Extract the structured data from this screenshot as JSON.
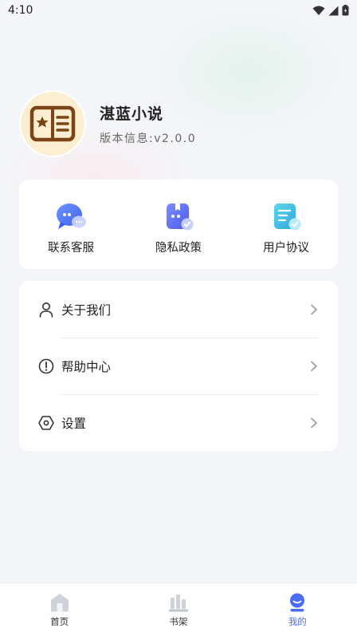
{
  "status_bar": {
    "time": "4:10"
  },
  "profile": {
    "name": "湛蓝小说",
    "version": "版本信息:v2.0.0"
  },
  "shortcuts": [
    {
      "label": "联系客服",
      "icon": "chat-bubble-icon"
    },
    {
      "label": "隐私政策",
      "icon": "privacy-book-icon"
    },
    {
      "label": "用户协议",
      "icon": "agreement-doc-icon"
    }
  ],
  "menu": [
    {
      "label": "关于我们",
      "icon": "person-icon"
    },
    {
      "label": "帮助中心",
      "icon": "help-exclamation-icon"
    },
    {
      "label": "设置",
      "icon": "settings-hex-icon"
    }
  ],
  "bottom_nav": [
    {
      "label": "首页",
      "icon": "home-icon",
      "active": false
    },
    {
      "label": "书架",
      "icon": "bookshelf-icon",
      "active": false
    },
    {
      "label": "我的",
      "icon": "profile-icon",
      "active": true
    }
  ],
  "colors": {
    "accent": "#4a6cf7",
    "background": "#f4f5f8",
    "avatar_bg": "#fcefd1",
    "avatar_icon": "#7a4416"
  }
}
